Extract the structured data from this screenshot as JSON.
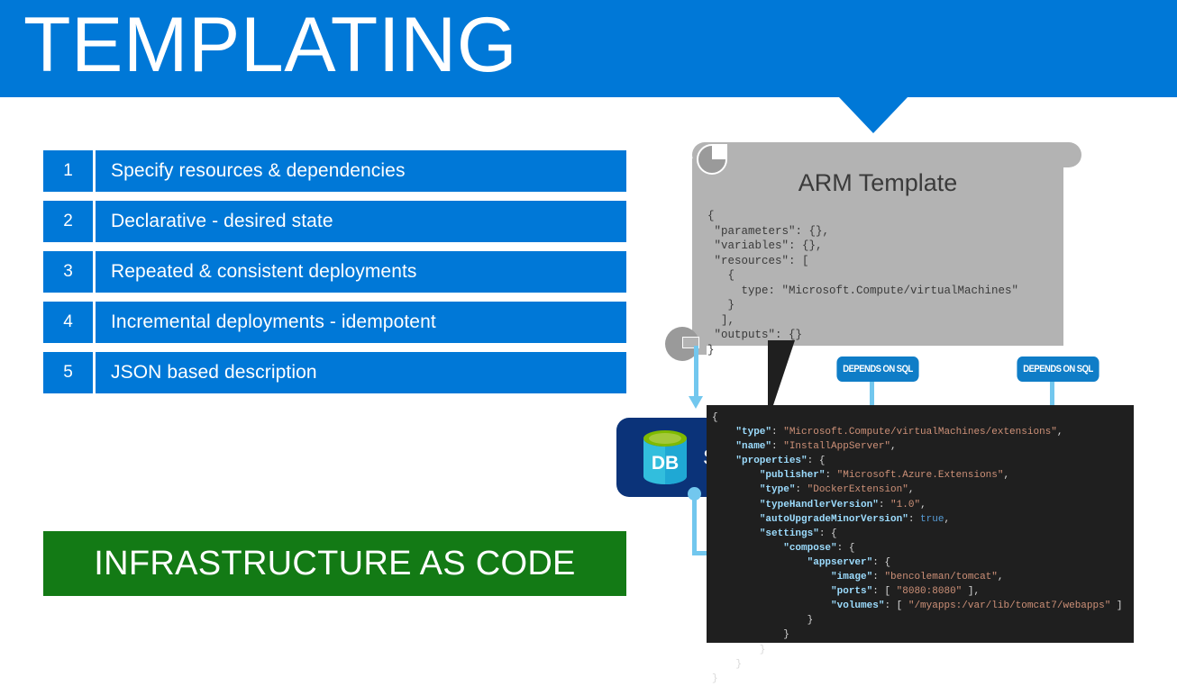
{
  "slide": {
    "title": "TEMPLATING",
    "footer_banner": "INFRASTRUCTURE AS CODE"
  },
  "colors": {
    "banner_blue": "#0078D7",
    "list_blue": "#0078D7",
    "green": "#137A15",
    "connector_blue": "#72C7EE",
    "badge_blue": "#0F7DC7",
    "tile_navy": "#0B3379",
    "scroll_gray": "#B3B3B3",
    "code_panel_bg": "#1F1F1F"
  },
  "list": {
    "items": [
      {
        "num": "1",
        "label": "Specify resources & dependencies"
      },
      {
        "num": "2",
        "label": "Declarative - desired state"
      },
      {
        "num": "3",
        "label": "Repeated & consistent deployments"
      },
      {
        "num": "4",
        "label": "Incremental deployments - idempotent"
      },
      {
        "num": "5",
        "label": "JSON based description"
      }
    ]
  },
  "arm_template": {
    "title": "ARM Template",
    "code": "{\n \"parameters\": {},\n \"variables\": {},\n \"resources\": [\n   {\n     type: \"Microsoft.Compute/virtualMachines\"\n   }\n  ],\n \"outputs\": {}\n}"
  },
  "badges": [
    {
      "label": "DEPENDS ON SQL"
    },
    {
      "label": "DEPENDS ON SQL"
    }
  ],
  "tiles": {
    "sql": {
      "label": "SQL",
      "icon_label": "DB"
    }
  },
  "code_panel": {
    "lines": [
      [
        {
          "t": "{",
          "c": "p"
        }
      ],
      [
        {
          "t": "    ",
          "c": "p"
        },
        {
          "t": "\"type\"",
          "c": "k"
        },
        {
          "t": ": ",
          "c": "p"
        },
        {
          "t": "\"Microsoft.Compute/virtualMachines/extensions\"",
          "c": "s"
        },
        {
          "t": ",",
          "c": "p"
        }
      ],
      [
        {
          "t": "    ",
          "c": "p"
        },
        {
          "t": "\"name\"",
          "c": "k"
        },
        {
          "t": ": ",
          "c": "p"
        },
        {
          "t": "\"InstallAppServer\"",
          "c": "s"
        },
        {
          "t": ",",
          "c": "p"
        }
      ],
      [
        {
          "t": "    ",
          "c": "p"
        },
        {
          "t": "\"properties\"",
          "c": "k"
        },
        {
          "t": ": {",
          "c": "p"
        }
      ],
      [
        {
          "t": "        ",
          "c": "p"
        },
        {
          "t": "\"publisher\"",
          "c": "k"
        },
        {
          "t": ": ",
          "c": "p"
        },
        {
          "t": "\"Microsoft.Azure.Extensions\"",
          "c": "s"
        },
        {
          "t": ",",
          "c": "p"
        }
      ],
      [
        {
          "t": "        ",
          "c": "p"
        },
        {
          "t": "\"type\"",
          "c": "k"
        },
        {
          "t": ": ",
          "c": "p"
        },
        {
          "t": "\"DockerExtension\"",
          "c": "s"
        },
        {
          "t": ",",
          "c": "p"
        }
      ],
      [
        {
          "t": "        ",
          "c": "p"
        },
        {
          "t": "\"typeHandlerVersion\"",
          "c": "k"
        },
        {
          "t": ": ",
          "c": "p"
        },
        {
          "t": "\"1.0\"",
          "c": "s"
        },
        {
          "t": ",",
          "c": "p"
        }
      ],
      [
        {
          "t": "        ",
          "c": "p"
        },
        {
          "t": "\"autoUpgradeMinorVersion\"",
          "c": "k"
        },
        {
          "t": ": ",
          "c": "p"
        },
        {
          "t": "true",
          "c": "b"
        },
        {
          "t": ",",
          "c": "p"
        }
      ],
      [
        {
          "t": "        ",
          "c": "p"
        },
        {
          "t": "\"settings\"",
          "c": "k"
        },
        {
          "t": ": {",
          "c": "p"
        }
      ],
      [
        {
          "t": "            ",
          "c": "p"
        },
        {
          "t": "\"compose\"",
          "c": "k"
        },
        {
          "t": ": {",
          "c": "p"
        }
      ],
      [
        {
          "t": "                ",
          "c": "p"
        },
        {
          "t": "\"appserver\"",
          "c": "k"
        },
        {
          "t": ": {",
          "c": "p"
        }
      ],
      [
        {
          "t": "                    ",
          "c": "p"
        },
        {
          "t": "\"image\"",
          "c": "k"
        },
        {
          "t": ": ",
          "c": "p"
        },
        {
          "t": "\"bencoleman/tomcat\"",
          "c": "s"
        },
        {
          "t": ",",
          "c": "p"
        }
      ],
      [
        {
          "t": "                    ",
          "c": "p"
        },
        {
          "t": "\"ports\"",
          "c": "k"
        },
        {
          "t": ": [ ",
          "c": "p"
        },
        {
          "t": "\"8080:8080\"",
          "c": "s"
        },
        {
          "t": " ],",
          "c": "p"
        }
      ],
      [
        {
          "t": "                    ",
          "c": "p"
        },
        {
          "t": "\"volumes\"",
          "c": "k"
        },
        {
          "t": ": [ ",
          "c": "p"
        },
        {
          "t": "\"/myapps:/var/lib/tomcat7/webapps\"",
          "c": "s"
        },
        {
          "t": " ]",
          "c": "p"
        }
      ],
      [
        {
          "t": "                }",
          "c": "p"
        }
      ],
      [
        {
          "t": "            }",
          "c": "p"
        }
      ],
      [
        {
          "t": "        }",
          "c": "p"
        }
      ],
      [
        {
          "t": "    }",
          "c": "p"
        }
      ],
      [
        {
          "t": "}",
          "c": "p"
        }
      ]
    ]
  }
}
